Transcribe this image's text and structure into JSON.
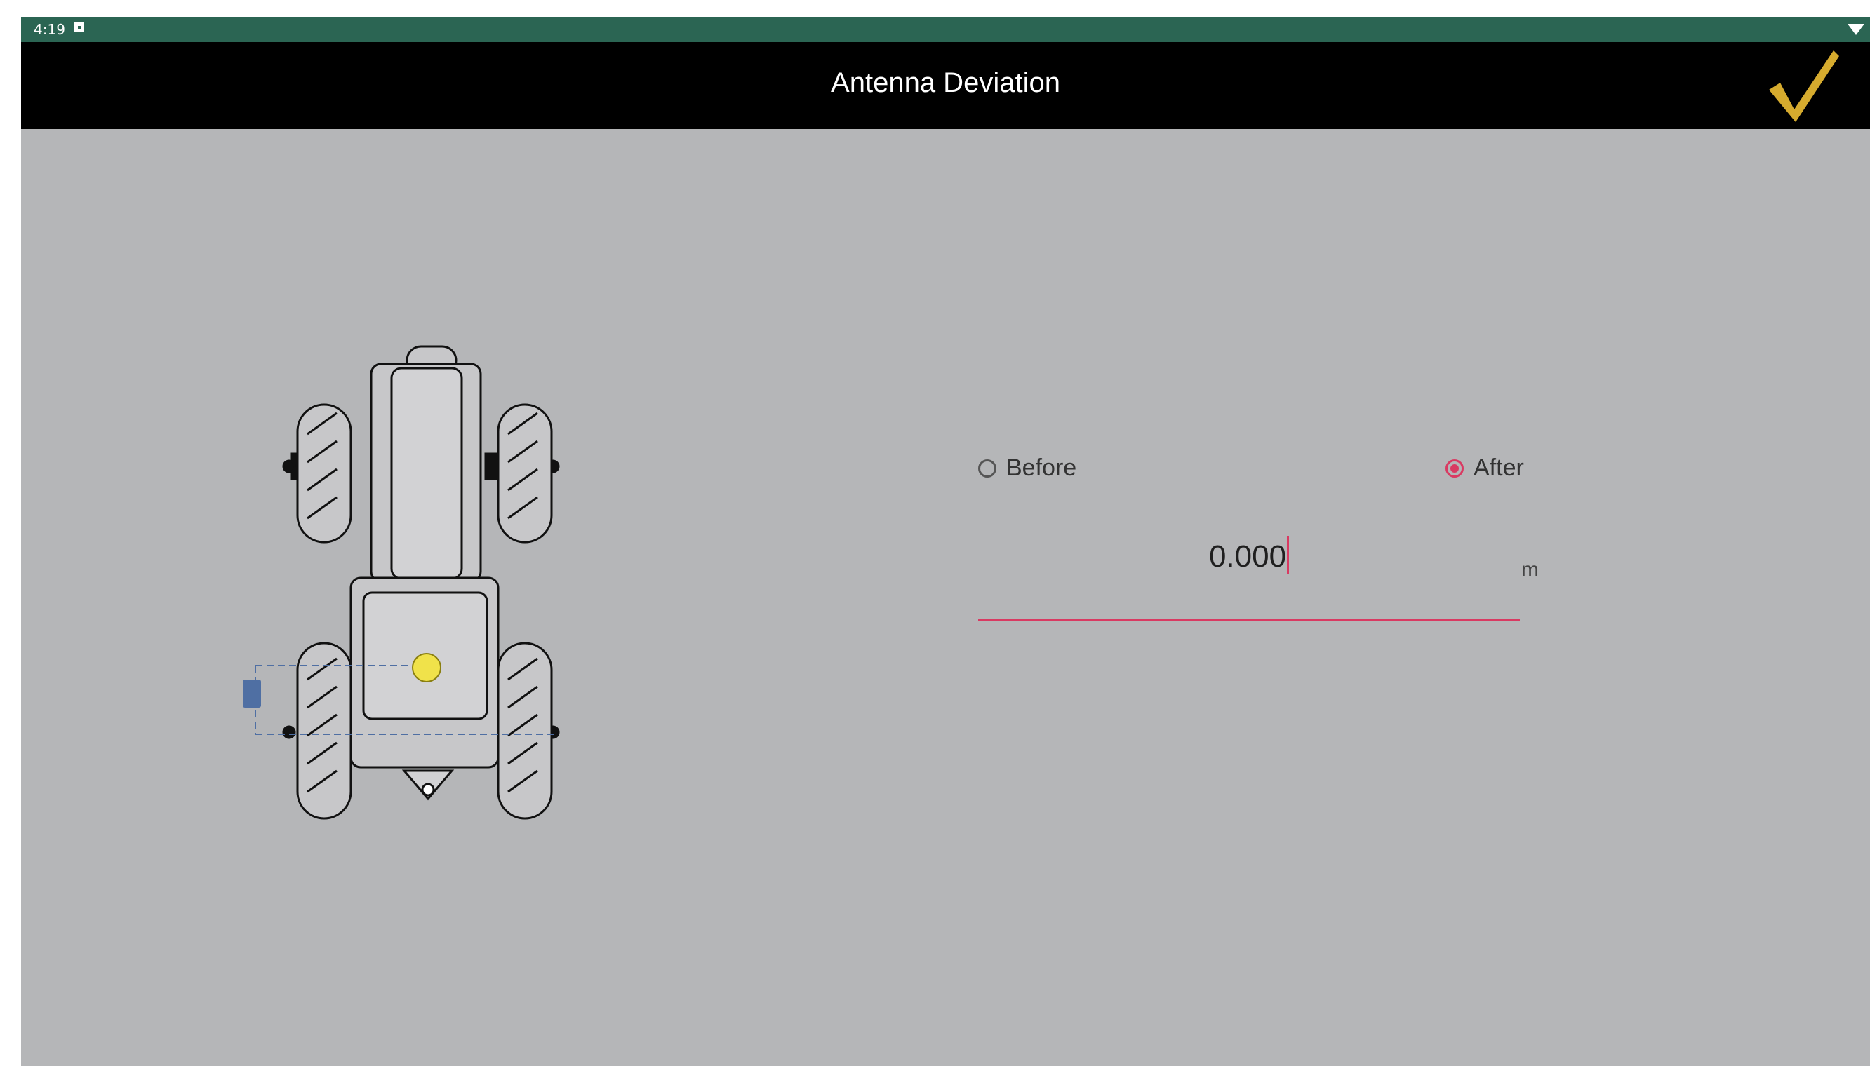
{
  "status_bar": {
    "time": "4:19",
    "icons": [
      "notification-icon",
      "wifi-icon"
    ]
  },
  "app_bar": {
    "title": "Antenna Deviation",
    "confirm_icon": "checkmark-icon"
  },
  "options": {
    "before_label": "Before",
    "after_label": "After",
    "selected": "After"
  },
  "value": {
    "current": "0.000",
    "unit": "m"
  },
  "colors": {
    "status_bar": "#2b6553",
    "app_bar": "#000000",
    "background": "#b5b6b8",
    "accent": "#d93a62",
    "checkmark": "#d6ab2e",
    "antenna_marker": "#f0e24a",
    "implement": "#4f6fa3"
  }
}
